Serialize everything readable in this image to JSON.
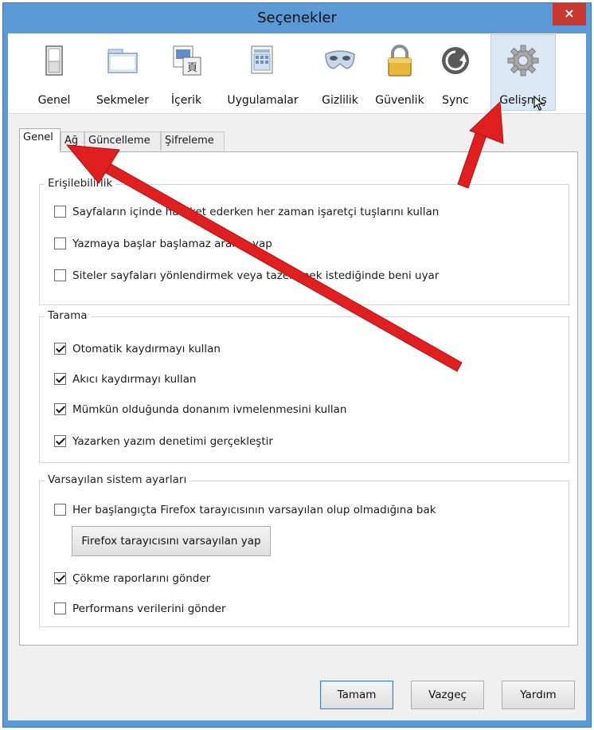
{
  "window": {
    "title": "Seçenekler",
    "close_label": "×"
  },
  "toolbar": {
    "items": [
      {
        "label": "Genel",
        "icon": "switch-icon"
      },
      {
        "label": "Sekmeler",
        "icon": "window-tabs-icon"
      },
      {
        "label": "İçerik",
        "icon": "content-image-icon"
      },
      {
        "label": "Uygulamalar",
        "icon": "applications-icon"
      },
      {
        "label": "Gizlilik",
        "icon": "mask-icon"
      },
      {
        "label": "Güvenlik",
        "icon": "lock-icon"
      },
      {
        "label": "Sync",
        "icon": "sync-icon"
      },
      {
        "label": "Gelişmiş",
        "icon": "gear-icon",
        "selected": true
      }
    ]
  },
  "subtabs": [
    {
      "label": "Genel",
      "active": true
    },
    {
      "label": "Ağ"
    },
    {
      "label": "Güncelleme"
    },
    {
      "label": "Şifreleme"
    }
  ],
  "groups": {
    "accessibility": {
      "title": "Erişilebilirlik",
      "options": [
        {
          "label": "Sayfaların içinde hareket ederken her zaman işaretçi tuşlarını kullan",
          "checked": false
        },
        {
          "label": "Yazmaya başlar başlamaz arama yap",
          "checked": false
        },
        {
          "label": "Siteler sayfaları yönlendirmek veya tazelemek istediğinde beni uyar",
          "checked": false
        }
      ]
    },
    "browsing": {
      "title": "Tarama",
      "options": [
        {
          "label": "Otomatik kaydırmayı kullan",
          "checked": true
        },
        {
          "label": "Akıcı kaydırmayı kullan",
          "checked": true
        },
        {
          "label": "Mümkün olduğunda donanım ivmelenmesini kullan",
          "checked": true
        },
        {
          "label": "Yazarken yazım denetimi gerçekleştir",
          "checked": true
        }
      ]
    },
    "system_defaults": {
      "title": "Varsayılan sistem ayarları",
      "options": [
        {
          "label": "Her başlangıçta Firefox tarayıcısının varsayılan olup olmadığına bak",
          "checked": false
        },
        {
          "label": "Çökme raporlarını gönder",
          "checked": true
        },
        {
          "label": "Performans verilerini gönder",
          "checked": false
        }
      ],
      "make_default_button": "Firefox tarayıcısını varsayılan yap"
    }
  },
  "footer": {
    "ok": "Tamam",
    "cancel": "Vazgeç",
    "help": "Yardım"
  },
  "colors": {
    "arrow": "#e02020",
    "titlebar": "#5b9ad6",
    "close": "#c7382e"
  }
}
